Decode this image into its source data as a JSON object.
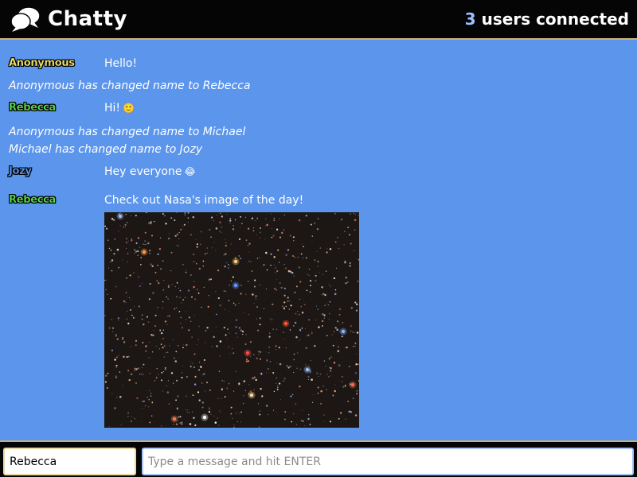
{
  "header": {
    "brand": "Chatty",
    "user_count": "3",
    "users_label": "users connected"
  },
  "messages": [
    {
      "type": "chat",
      "username": "Anonymous",
      "username_color": "#f3e36b",
      "text": "Hello!"
    },
    {
      "type": "system",
      "text": "Anonymous has changed name to Rebecca"
    },
    {
      "type": "chat",
      "username": "Rebecca",
      "username_color": "#57d64b",
      "text": "Hi!",
      "emoji": "🙂"
    },
    {
      "type": "system",
      "text": "Anonymous has changed name to Michael"
    },
    {
      "type": "system",
      "text": "Michael has changed name to Jozy"
    },
    {
      "type": "chat",
      "username": "Jozy",
      "username_color": "#5b95ec",
      "text": "Hey everyone",
      "emoji": "😂"
    },
    {
      "type": "chat",
      "username": "Rebecca",
      "username_color": "#57d64b",
      "text": "Check out Nasa's image of the day!",
      "image": "starfield"
    }
  ],
  "composer": {
    "name_value": "Rebecca",
    "message_placeholder": "Type a message and hit ENTER"
  },
  "icons": {
    "logo": "speech-bubbles-icon"
  }
}
